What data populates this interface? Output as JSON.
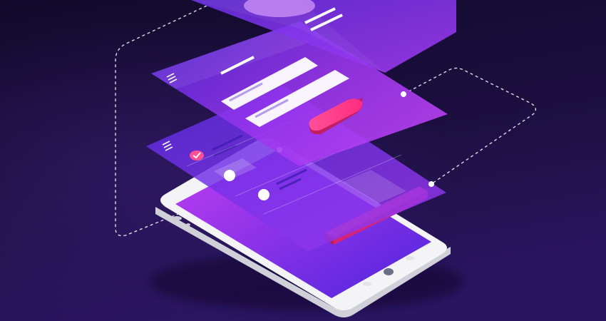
{
  "illustration": {
    "subject": "isometric-smartphone-with-floating-ui-layers",
    "colors": {
      "background_top": "#120a2b",
      "background_bottom": "#2a1560",
      "phone_body": "#f4f4f6",
      "phone_edge": "#d9d9df",
      "screen_from": "#b43cf0",
      "screen_to": "#5a26e0",
      "layer_from": "#9a3cf0",
      "layer_to": "#5b2be6",
      "accent_pink": "#ff3d8c",
      "accent_pink_dark": "#c21e62",
      "white": "#ffffff"
    },
    "layers": [
      {
        "name": "top-layer",
        "elements": [
          "circle",
          "text-lines"
        ]
      },
      {
        "name": "form-layer",
        "elements": [
          "menu-icon",
          "title-line",
          "input-field",
          "input-field",
          "pink-button"
        ]
      },
      {
        "name": "list-layer",
        "elements": [
          "menu-icon",
          "check-badge",
          "list-rows",
          "slider-knobs"
        ]
      },
      {
        "name": "screen-layer",
        "elements": [
          "pink-bar"
        ]
      }
    ]
  }
}
